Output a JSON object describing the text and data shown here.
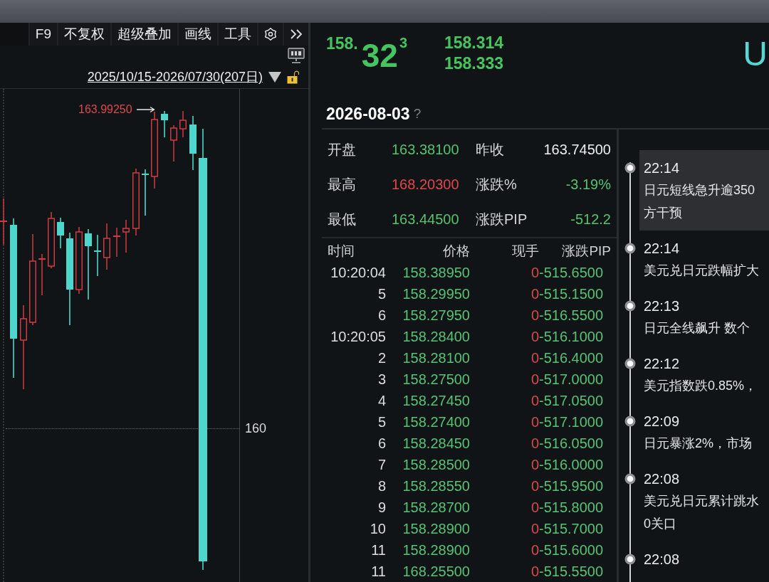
{
  "toolbar": {
    "items": [
      {
        "kind": "text",
        "label": "F9"
      },
      {
        "kind": "text",
        "label": "不复权"
      },
      {
        "kind": "text",
        "label": "超级叠加"
      },
      {
        "kind": "text",
        "label": "画线"
      },
      {
        "kind": "text",
        "label": "工具"
      },
      {
        "kind": "settings"
      },
      {
        "kind": "more"
      }
    ]
  },
  "date_range": {
    "label": "2025/10/15-2026/07/30(207日)"
  },
  "chart": {
    "high_marker": "163.99250",
    "axis_label": "160"
  },
  "quote": {
    "price_prefix": "158.",
    "price_main": "32",
    "price_pip": "3",
    "side_prices": [
      "158.314",
      "158.333"
    ],
    "title_fragment": "U"
  },
  "date": {
    "title": "2026-08-03",
    "help_mark": "?"
  },
  "stats": [
    {
      "label": "开盘",
      "value": "163.38100",
      "color": "#55c26f"
    },
    {
      "label": "昨收",
      "value": "163.74500",
      "color": "#ededed"
    },
    {
      "label": "最高",
      "value": "168.20300",
      "color": "#e0474d"
    },
    {
      "label": "涨跌%",
      "value": "-3.19%",
      "color": "#55c26f"
    },
    {
      "label": "最低",
      "value": "163.44500",
      "color": "#55c26f"
    },
    {
      "label": "涨跌PIP",
      "value": "-512.2",
      "color": "#55c26f"
    }
  ],
  "trades": {
    "columns": [
      "时间",
      "价格",
      "现手",
      "涨跌PIP"
    ],
    "rows": [
      {
        "time": "10:20:04",
        "price": "158.38950",
        "volume": "0",
        "change_pip": "-515.6500"
      },
      {
        "time": "5",
        "price": "158.29950",
        "volume": "0",
        "change_pip": "-515.1500"
      },
      {
        "time": "6",
        "price": "158.27950",
        "volume": "0",
        "change_pip": "-516.5500"
      },
      {
        "time": "10:20:05",
        "price": "158.28400",
        "volume": "0",
        "change_pip": "-516.1000"
      },
      {
        "time": "2",
        "price": "158.28100",
        "volume": "0",
        "change_pip": "-516.4000"
      },
      {
        "time": "3",
        "price": "158.27500",
        "volume": "0",
        "change_pip": "-517.0000"
      },
      {
        "time": "4",
        "price": "158.27450",
        "volume": "0",
        "change_pip": "-517.0500"
      },
      {
        "time": "5",
        "price": "158.27400",
        "volume": "0",
        "change_pip": "-517.1000"
      },
      {
        "time": "6",
        "price": "158.28450",
        "volume": "0",
        "change_pip": "-516.0500"
      },
      {
        "time": "7",
        "price": "158.28500",
        "volume": "0",
        "change_pip": "-516.0000"
      },
      {
        "time": "8",
        "price": "158.28550",
        "volume": "0",
        "change_pip": "-515.9500"
      },
      {
        "time": "9",
        "price": "158.28700",
        "volume": "0",
        "change_pip": "-515.8000"
      },
      {
        "time": "10",
        "price": "158.28900",
        "volume": "0",
        "change_pip": "-515.7000"
      },
      {
        "time": "11",
        "price": "158.28900",
        "volume": "0",
        "change_pip": "-515.6000"
      },
      {
        "time": "11",
        "price": "168.25500",
        "volume": "0",
        "change_pip": "-515.5500"
      }
    ]
  },
  "news": [
    {
      "time": "22:14",
      "lines": [
        "日元短线急升逾350",
        "方干预"
      ],
      "selected": true
    },
    {
      "time": "22:14",
      "lines": [
        "美元兑日元跌幅扩大"
      ],
      "selected": false
    },
    {
      "time": "22:13",
      "lines": [
        "日元全线飙升 数个"
      ],
      "selected": false
    },
    {
      "time": "22:12",
      "lines": [
        "美元指数跌0.85%，"
      ],
      "selected": false
    },
    {
      "time": "22:09",
      "lines": [
        "日元暴涨2%，市场"
      ],
      "selected": false
    },
    {
      "time": "22:08",
      "lines": [
        "美元兑日元累计跳水",
        "0关口"
      ],
      "selected": false
    },
    {
      "time": "22:08",
      "selected": false
    }
  ]
}
